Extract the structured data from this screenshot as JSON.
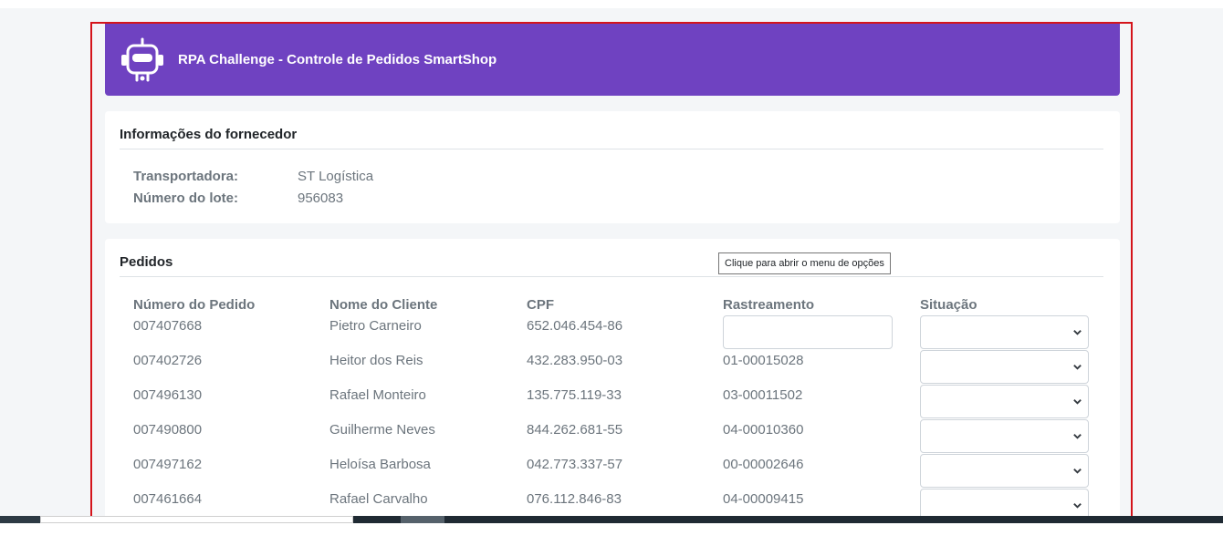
{
  "header": {
    "title": "RPA Challenge - Controle de Pedidos SmartShop",
    "icon": "robot-icon",
    "color": "#6f42c1"
  },
  "supplier": {
    "title": "Informações do fornecedor",
    "carrier_label": "Transportadora:",
    "carrier_value": "ST Logística",
    "batch_label": "Número do lote:",
    "batch_value": "956083"
  },
  "orders": {
    "title": "Pedidos",
    "tooltip": "Clique para abrir o menu de opções",
    "columns": [
      "Número do Pedido",
      "Nome do Cliente",
      "CPF",
      "Rastreamento",
      "Situação"
    ],
    "rows": [
      {
        "order": "007407668",
        "name": "Pietro Carneiro",
        "cpf": "652.046.454-86",
        "tracking": "",
        "tracking_input": true,
        "status": ""
      },
      {
        "order": "007402726",
        "name": "Heitor dos Reis",
        "cpf": "432.283.950-03",
        "tracking": "01-00015028",
        "tracking_input": false,
        "status": ""
      },
      {
        "order": "007496130",
        "name": "Rafael Monteiro",
        "cpf": "135.775.119-33",
        "tracking": "03-00011502",
        "tracking_input": false,
        "status": ""
      },
      {
        "order": "007490800",
        "name": "Guilherme Neves",
        "cpf": "844.262.681-55",
        "tracking": "04-00010360",
        "tracking_input": false,
        "status": ""
      },
      {
        "order": "007497162",
        "name": "Heloísa Barbosa",
        "cpf": "042.773.337-57",
        "tracking": "00-00002646",
        "tracking_input": false,
        "status": ""
      },
      {
        "order": "007461664",
        "name": "Rafael Carvalho",
        "cpf": "076.112.846-83",
        "tracking": "04-00009415",
        "tracking_input": false,
        "status": ""
      }
    ]
  },
  "colors": {
    "frame_border": "#d4141b",
    "muted_text": "#6c757d"
  }
}
